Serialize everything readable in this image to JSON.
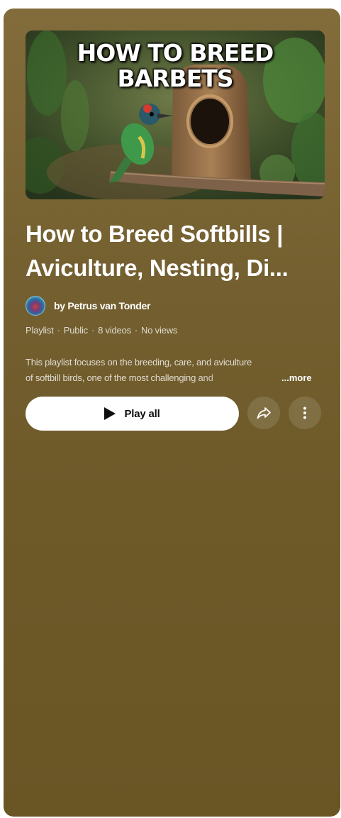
{
  "thumbnail": {
    "line1": "HOW TO BREED",
    "line2": "BARBETS"
  },
  "playlist": {
    "title_line1": "How to Breed Softbills |",
    "title_line2": "Aviculture, Nesting, Di...",
    "author": "by Petrus van Tonder",
    "type": "Playlist",
    "visibility": "Public",
    "video_count": "8 videos",
    "views": "No views",
    "meta_separator": "·",
    "description_line1": "This playlist focuses on the breeding, care, and aviculture",
    "description_line2": "of softbill birds, one of the most challenging and",
    "more_label": "...more"
  },
  "actions": {
    "play_all_label": "Play all",
    "share_icon": "share-icon",
    "more_icon": "more-vert-icon"
  },
  "colors": {
    "panel": "#735f2f",
    "button_bg": "#ffffff",
    "text": "#ffffff"
  }
}
